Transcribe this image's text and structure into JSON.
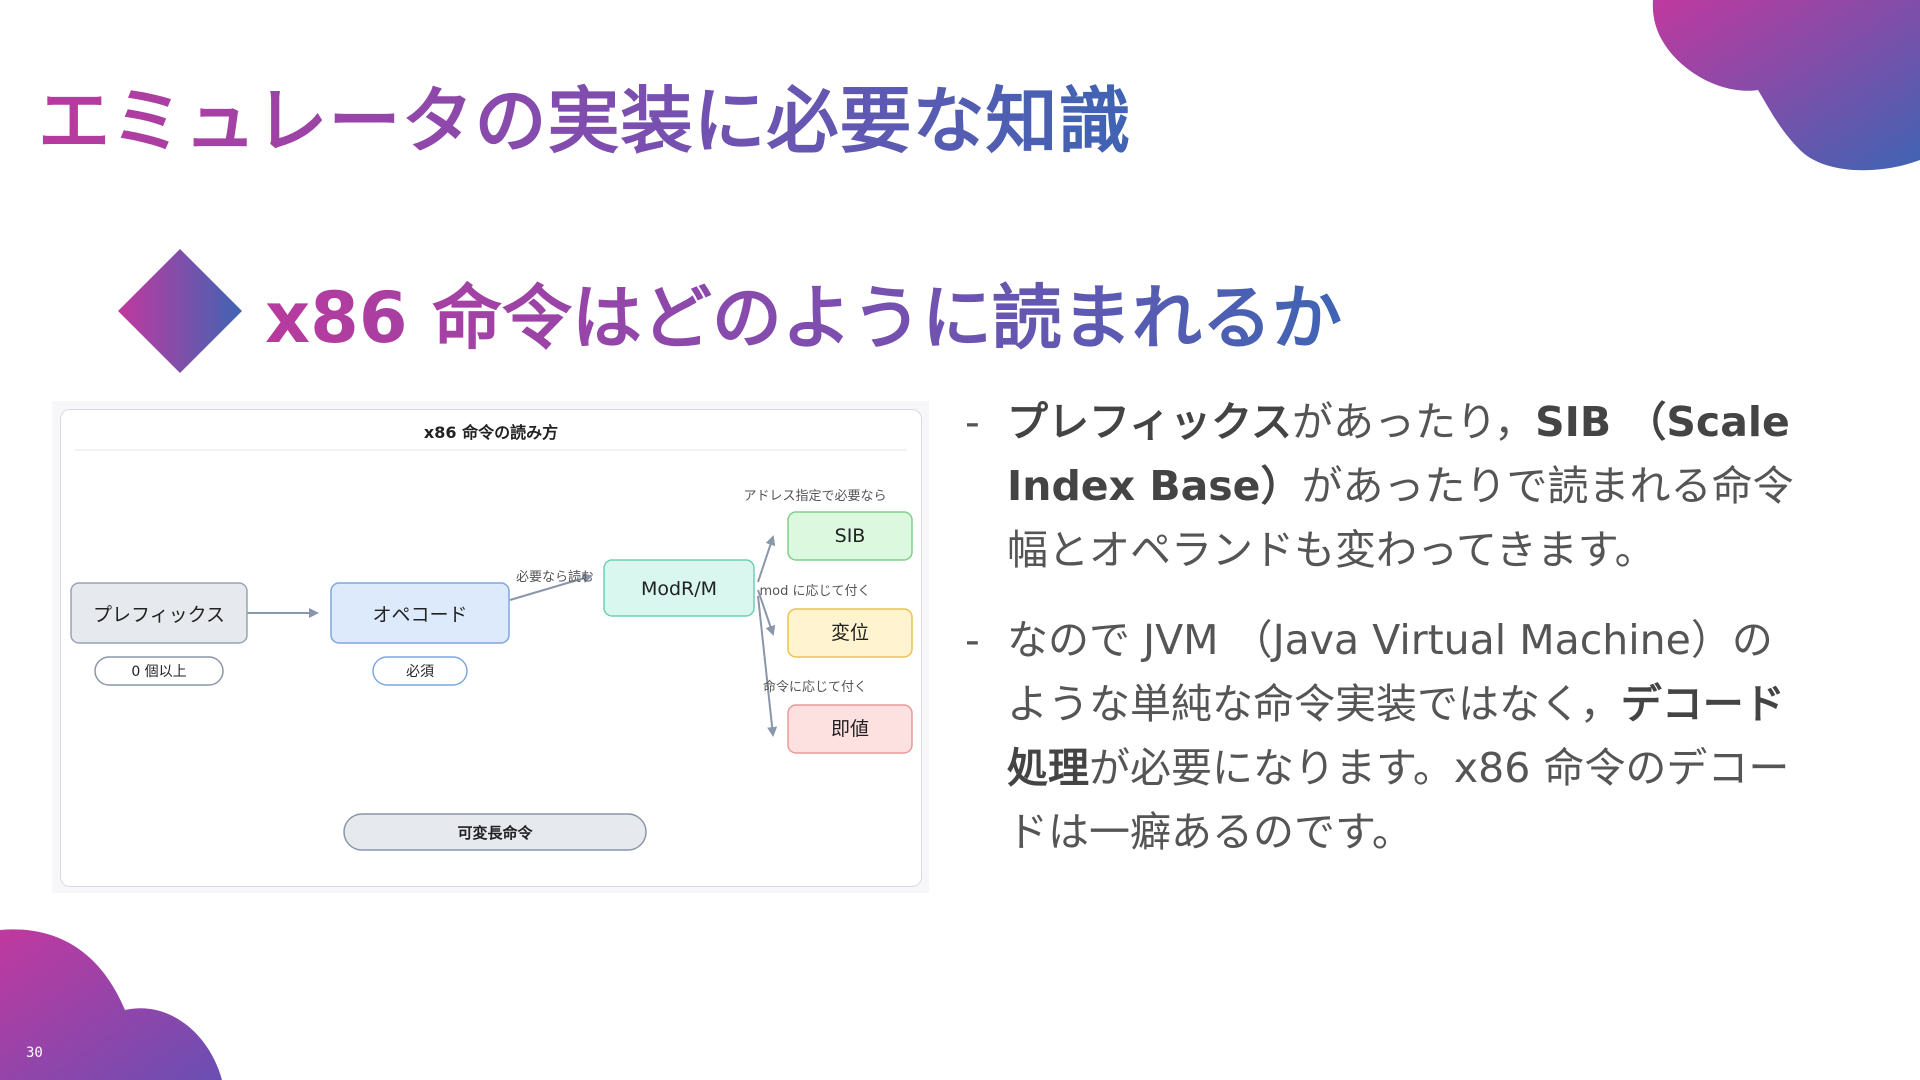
{
  "slide": {
    "title": "エミュレータの実装に必要な知識",
    "subtitle": "x86 命令はどのように読まれるか",
    "page_number": "30"
  },
  "colors": {
    "grad_start": "#c0399f",
    "grad_end": "#3f64b3"
  },
  "diagram": {
    "title": "x86 命令の読み方",
    "nodes": {
      "prefix": {
        "label": "プレフィックス",
        "note": "0 個以上"
      },
      "opcode": {
        "label": "オペコード",
        "note": "必須"
      },
      "modrm": {
        "label": "ModR/M"
      },
      "sib": {
        "label": "SIB"
      },
      "disp": {
        "label": "変位"
      },
      "imm": {
        "label": "即値"
      }
    },
    "edges": {
      "opcode_modrm": "必要なら読む",
      "modrm_sib": "アドレス指定で必要なら",
      "modrm_disp": "mod に応じて付く",
      "modrm_imm": "命令に応じて付く"
    },
    "footer": "可変長命令"
  },
  "bullets": [
    {
      "dash": "-",
      "parts": [
        {
          "text": "プレフィックス",
          "bold": true
        },
        {
          "text": "があったり，",
          "bold": false
        },
        {
          "text": "SIB （Scale Index Base）",
          "bold": true
        },
        {
          "text": "があったりで読まれる命令幅とオペランドも変わってきます。",
          "bold": false
        }
      ]
    },
    {
      "dash": "-",
      "parts": [
        {
          "text": "なので JVM （Java Virtual Machine）のような単純な命令実装ではなく，",
          "bold": false
        },
        {
          "text": "デコード処理",
          "bold": true
        },
        {
          "text": "が必要になります。x86 命令のデコードは一癖あるのです。",
          "bold": false
        }
      ]
    }
  ]
}
